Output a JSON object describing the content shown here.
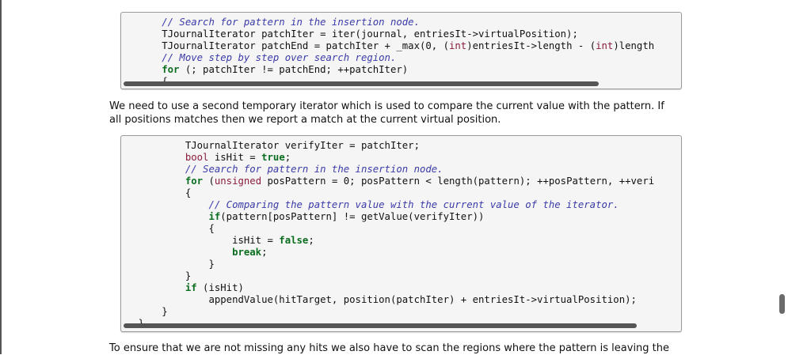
{
  "code_block_1": {
    "lines": [
      [
        {
          "t": "cm",
          "v": "        // Search for pattern in the insertion node."
        }
      ],
      [
        {
          "t": "nm",
          "v": "        TJournalIterator patchIter = iter(journal, entriesIt->virtualPosition);"
        }
      ],
      [
        {
          "t": "nm",
          "v": "        TJournalIterator patchEnd = patchIter + _max(0, ("
        },
        {
          "t": "ty",
          "v": "int"
        },
        {
          "t": "nm",
          "v": ")entriesIt->length - ("
        },
        {
          "t": "ty",
          "v": "int"
        },
        {
          "t": "nm",
          "v": ")length"
        }
      ],
      [
        {
          "t": "cm",
          "v": "        // Move step by step over search region."
        }
      ],
      [
        {
          "t": "kw",
          "v": "        for"
        },
        {
          "t": "nm",
          "v": " (; patchIter != patchEnd; ++patchIter)"
        }
      ],
      [
        {
          "t": "nm",
          "v": "        {"
        }
      ]
    ]
  },
  "paragraph_1": {
    "line1": "We need to use a second temporary iterator which is used to compare the current value with the pattern. If",
    "line2": "all positions matches then we report a match at the current virtual position."
  },
  "code_block_2": {
    "lines": [
      [
        {
          "t": "nm",
          "v": "            TJournalIterator verifyIter = patchIter;"
        }
      ],
      [
        {
          "t": "ty",
          "v": "            bool"
        },
        {
          "t": "nm",
          "v": " isHit = "
        },
        {
          "t": "kw",
          "v": "true"
        },
        {
          "t": "nm",
          "v": ";"
        }
      ],
      [
        {
          "t": "cm",
          "v": "            // Search for pattern in the insertion node."
        }
      ],
      [
        {
          "t": "kw",
          "v": "            for"
        },
        {
          "t": "nm",
          "v": " ("
        },
        {
          "t": "ty",
          "v": "unsigned"
        },
        {
          "t": "nm",
          "v": " posPattern = 0; posPattern < length(pattern); ++posPattern, ++veri"
        }
      ],
      [
        {
          "t": "nm",
          "v": "            {"
        }
      ],
      [
        {
          "t": "cm",
          "v": "                // Comparing the pattern value with the current value of the iterator."
        }
      ],
      [
        {
          "t": "kw",
          "v": "                if"
        },
        {
          "t": "nm",
          "v": "(pattern[posPattern] != getValue(verifyIter))"
        }
      ],
      [
        {
          "t": "nm",
          "v": "                {"
        }
      ],
      [
        {
          "t": "nm",
          "v": "                    isHit = "
        },
        {
          "t": "kw",
          "v": "false"
        },
        {
          "t": "nm",
          "v": ";"
        }
      ],
      [
        {
          "t": "kw",
          "v": "                    break"
        },
        {
          "t": "nm",
          "v": ";"
        }
      ],
      [
        {
          "t": "nm",
          "v": "                }"
        }
      ],
      [
        {
          "t": "nm",
          "v": "            }"
        }
      ],
      [
        {
          "t": "kw",
          "v": "            if"
        },
        {
          "t": "nm",
          "v": " (isHit)"
        }
      ],
      [
        {
          "t": "nm",
          "v": "                appendValue(hitTarget, position(patchIter) + entriesIt->virtualPosition);"
        }
      ],
      [
        {
          "t": "nm",
          "v": "        }"
        }
      ],
      [
        {
          "t": "nm",
          "v": "    }"
        }
      ]
    ]
  },
  "paragraph_2": {
    "line1": "To ensure that we are not missing any hits we also have to scan the regions where the pattern is leaving the"
  },
  "colors": {
    "keyword": "#0a6e1e",
    "type": "#8a1d3b",
    "comment": "#3a3aa8",
    "code_background": "#f5f5f5"
  }
}
